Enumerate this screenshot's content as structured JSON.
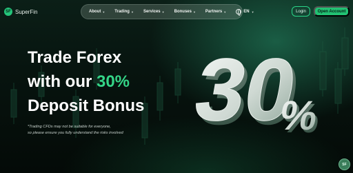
{
  "brand": {
    "name": "SuperFin",
    "logo_mark": "SF"
  },
  "nav": {
    "items": [
      {
        "label": "About"
      },
      {
        "label": "Trading"
      },
      {
        "label": "Services"
      },
      {
        "label": "Bonuses"
      },
      {
        "label": "Partners"
      }
    ],
    "language": "EN"
  },
  "auth": {
    "login": "Login",
    "open_account": "Open Account"
  },
  "hero": {
    "line1": "Trade Forex",
    "line2_prefix": "with our ",
    "line2_accent": "30%",
    "line3": "Deposit Bonus",
    "disclaimer_line1": "*Trading CFDs may not be suitable for everyone,",
    "disclaimer_line2": "so please ensure you fully understand the risks involved",
    "graphic": {
      "digits": "30",
      "percent": "%"
    }
  },
  "chat": {
    "label": "SF"
  },
  "colors": {
    "accent": "#22c173",
    "background": "#040b08"
  }
}
